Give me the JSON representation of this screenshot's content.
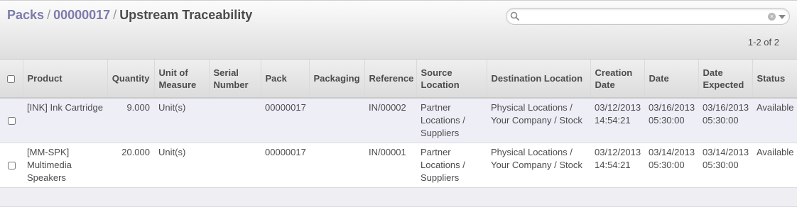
{
  "breadcrumb": {
    "items": [
      "Packs",
      "00000017"
    ],
    "current": "Upstream Traceability",
    "separator": "/"
  },
  "search": {
    "value": "",
    "placeholder": ""
  },
  "pager": {
    "text": "1-2 of 2"
  },
  "table": {
    "columns": [
      "Product",
      "Quantity",
      "Unit of Measure",
      "Serial Number",
      "Pack",
      "Packaging",
      "Reference",
      "Source Location",
      "Destination Location",
      "Creation Date",
      "Date",
      "Date Expected",
      "Status"
    ],
    "rows": [
      {
        "product": "[INK] Ink Cartridge",
        "quantity": "9.000",
        "uom": "Unit(s)",
        "serial": "",
        "pack": "00000017",
        "packaging": "",
        "reference": "IN/00002",
        "source": "Partner Locations / Suppliers",
        "destination": "Physical Locations / Your Company / Stock",
        "creation_date": "03/12/2013 14:54:21",
        "date": "03/16/2013 05:30:00",
        "date_expected": "03/16/2013 05:30:00",
        "status": "Available"
      },
      {
        "product": "[MM-SPK] Multimedia Speakers",
        "quantity": "20.000",
        "uom": "Unit(s)",
        "serial": "",
        "pack": "00000017",
        "packaging": "",
        "reference": "IN/00001",
        "source": "Partner Locations / Suppliers",
        "destination": "Physical Locations / Your Company / Stock",
        "creation_date": "03/12/2013 14:54:21",
        "date": "03/14/2013 05:30:00",
        "date_expected": "03/14/2013 05:30:00",
        "status": "Available"
      }
    ]
  },
  "colors": {
    "breadcrumb_link": "#7c7bad",
    "row_highlight": "#eeeef7",
    "text": "#4c4c4c"
  }
}
